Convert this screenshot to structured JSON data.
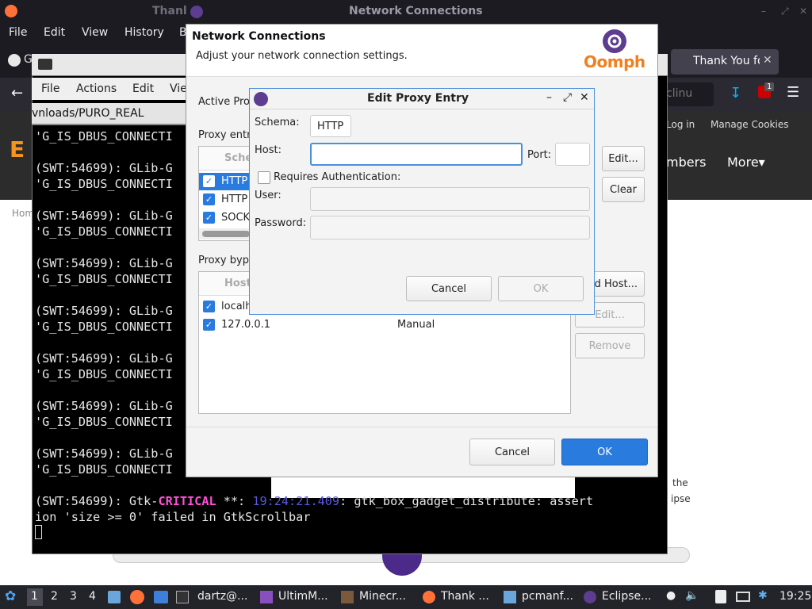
{
  "firefox": {
    "window_title": "Network Connections",
    "title_prefix": "Thanl",
    "menu": [
      "File",
      "Edit",
      "View",
      "History",
      "B"
    ],
    "tab_active": "Thank You fo",
    "tab_left_prefix": "G",
    "url_fragment": "clinu",
    "notification_count": "1",
    "web": {
      "login": "Log in",
      "manage_cookies": "Manage Cookies",
      "members": "mbers",
      "more": "More",
      "home": "Hom",
      "side_text_1": "the",
      "side_text_2": "ipse"
    }
  },
  "terminal": {
    "menu": [
      "File",
      "Actions",
      "Edit",
      "Vie"
    ],
    "tab_title": "vnloads/PURO_REAL",
    "lines": [
      "'G_IS_DBUS_CONNECTI",
      "",
      "(SWT:54699): GLib-G",
      "'G_IS_DBUS_CONNECTI",
      "",
      "(SWT:54699): GLib-G",
      "'G_IS_DBUS_CONNECTI",
      "",
      "(SWT:54699): GLib-G",
      "'G_IS_DBUS_CONNECTI",
      "",
      "(SWT:54699): GLib-G",
      "'G_IS_DBUS_CONNECTI",
      "",
      "(SWT:54699): GLib-G",
      "'G_IS_DBUS_CONNECTI",
      "",
      "(SWT:54699): GLib-G",
      "'G_IS_DBUS_CONNECTI",
      "",
      "(SWT:54699): GLib-G",
      "'G_IS_DBUS_CONNECTI"
    ],
    "last_prefix": "(SWT:54699): Gtk-",
    "last_level": "CRITICAL",
    "last_stars": " **: ",
    "last_time": "19:24:21.409",
    "last_msg": ": gtk_box_gadget_distribute: assert",
    "last_line2": "ion 'size >= 0' failed in GtkScrollbar"
  },
  "network_dialog": {
    "title": "Network Connections",
    "subtitle": "Adjust your network connection settings.",
    "logo_text": "Oomph",
    "active_provider_label": "Active Pro",
    "proxy_entries_label": "Proxy entri",
    "proxy_entries_header": "Sche",
    "proxy_entries": [
      {
        "schema": "HTTP",
        "checked": true,
        "selected": true
      },
      {
        "schema": "HTTP",
        "checked": true,
        "selected": false
      },
      {
        "schema": "SOCK",
        "checked": true,
        "selected": false
      }
    ],
    "proxy_bypass_label": "Proxy byp",
    "bypass_header": "Host",
    "bypass_entries": [
      {
        "host": "localh",
        "provider": "",
        "checked": true
      },
      {
        "host": "127.0.0.1",
        "provider": "Manual",
        "checked": true
      }
    ],
    "buttons": {
      "edit": "Edit...",
      "clear": "Clear",
      "add_host": "d Host...",
      "edit_host": "Edit...",
      "remove": "Remove",
      "cancel": "Cancel",
      "ok": "OK"
    }
  },
  "edit_proxy_dialog": {
    "title": "Edit Proxy Entry",
    "schema_label": "Schema:",
    "schema_value": "HTTP",
    "host_label": "Host:",
    "host_value": "",
    "port_label": "Port:",
    "port_value": "",
    "requires_auth_label": "Requires Authentication:",
    "requires_auth_checked": false,
    "user_label": "User:",
    "password_label": "Password:",
    "cancel": "Cancel",
    "ok": "OK"
  },
  "taskbar": {
    "workspaces": [
      "1",
      "2",
      "3",
      "4"
    ],
    "apps": [
      "dartz@...",
      "UltimM...",
      "Minecr...",
      "Thank ...",
      "pcmanf...",
      "Eclipse..."
    ],
    "clock": "19:25"
  },
  "colors": {
    "accent": "#2a7bde",
    "critical": "#ff4fd8",
    "oomph_orange": "#f08020",
    "oomph_purple": "#5c3d8f"
  }
}
